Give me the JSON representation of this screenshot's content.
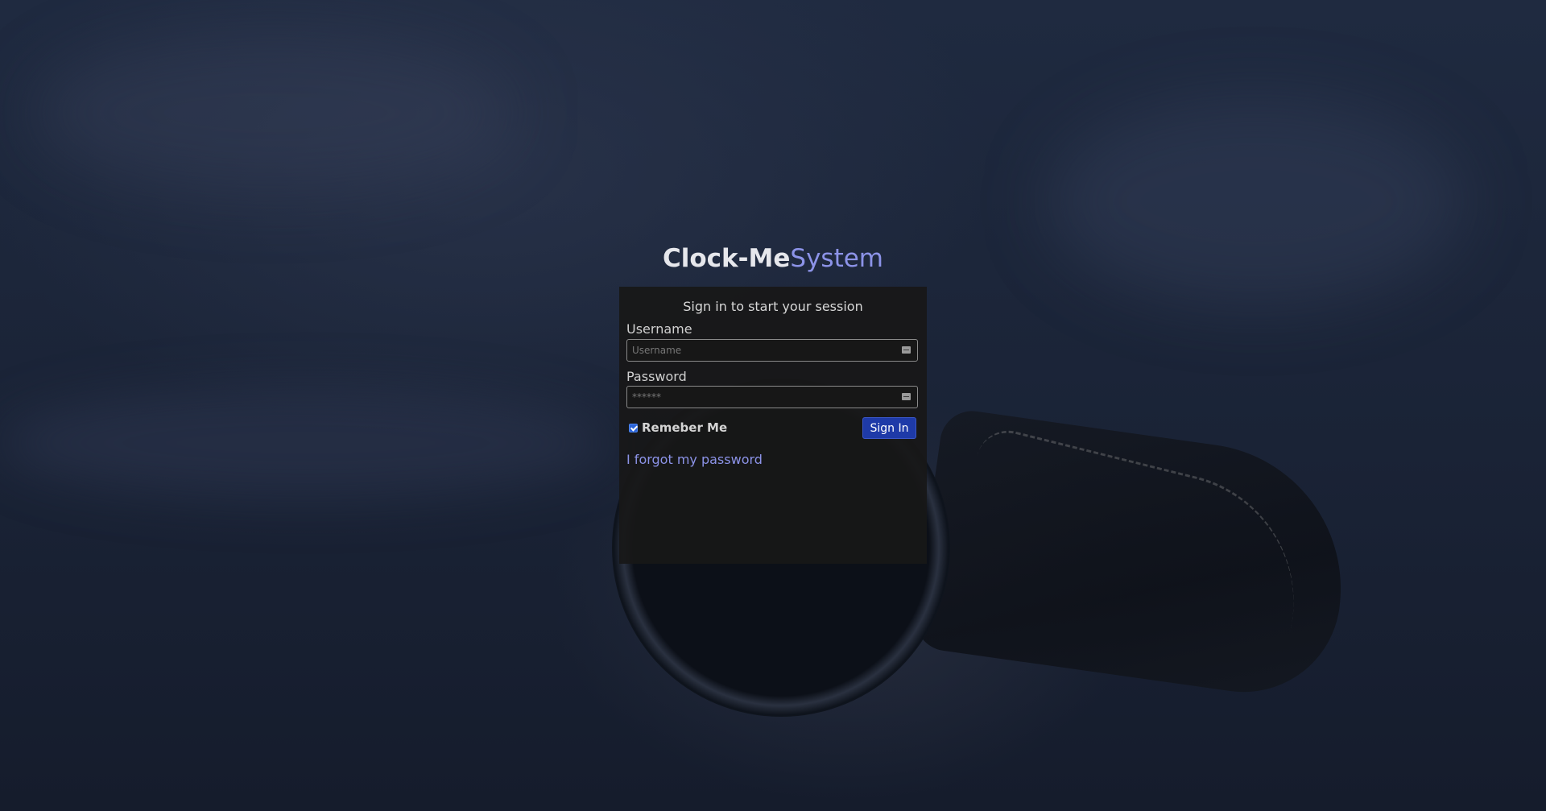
{
  "brand": {
    "name_bold": "Clock-Me",
    "name_light": "System"
  },
  "login": {
    "title": "Sign in to start your session",
    "username_label": "Username",
    "username_placeholder": "Username",
    "password_label": "Password",
    "password_placeholder": "******",
    "remember_label": "Remeber Me",
    "remember_checked": true,
    "signin_label": "Sign In",
    "forgot_label": "I forgot my password"
  },
  "icons": {
    "username_field_icon": "keyboard-icon",
    "password_field_icon": "keyboard-icon"
  },
  "colors": {
    "accent": "#8c93e8",
    "button": "#1e3aa8",
    "card": "#181818"
  }
}
